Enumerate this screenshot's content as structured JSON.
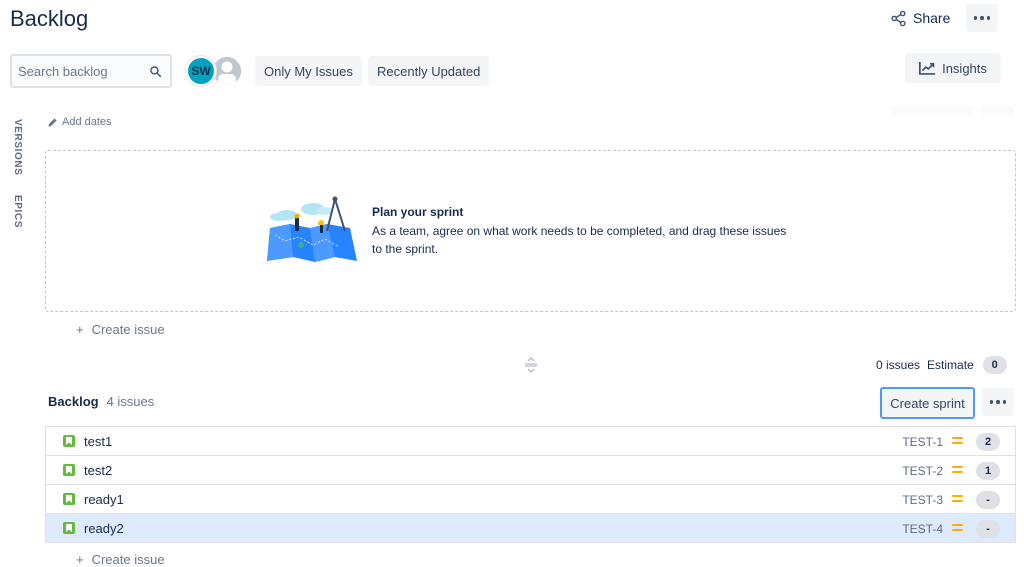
{
  "page": {
    "title": "Backlog"
  },
  "header": {
    "share_label": "Share"
  },
  "search": {
    "placeholder": "Search backlog"
  },
  "avatars": [
    {
      "initials": "SW",
      "color": "#00a3bf"
    }
  ],
  "filters": {
    "only_my_issues": "Only My Issues",
    "recently_updated": "Recently Updated"
  },
  "insights_label": "Insights",
  "side_tabs": {
    "versions": "VERSIONS",
    "epics": "EPICS"
  },
  "sprint": {
    "add_dates": "Add dates",
    "plan_title": "Plan your sprint",
    "plan_description": "As a team, agree on what work needs to be completed, and drag these issues to the sprint.",
    "create_issue": "Create issue",
    "issues_count": "0 issues",
    "estimate_label": "Estimate",
    "estimate_value": "0"
  },
  "backlog": {
    "name": "Backlog",
    "count": "4 issues",
    "create_sprint": "Create sprint",
    "issues": [
      {
        "summary": "test1",
        "key": "TEST-1",
        "points": "2",
        "priority": "medium"
      },
      {
        "summary": "test2",
        "key": "TEST-2",
        "points": "1",
        "priority": "medium"
      },
      {
        "summary": "ready1",
        "key": "TEST-3",
        "points": "-",
        "priority": "medium"
      },
      {
        "summary": "ready2",
        "key": "TEST-4",
        "points": "-",
        "priority": "medium",
        "selected": true
      }
    ],
    "create_issue": "Create issue"
  },
  "colors": {
    "story": "#63ba3c",
    "priority_medium": "#ffab00",
    "selected_row": "#deebff",
    "focus_ring": "#4c9aff"
  }
}
